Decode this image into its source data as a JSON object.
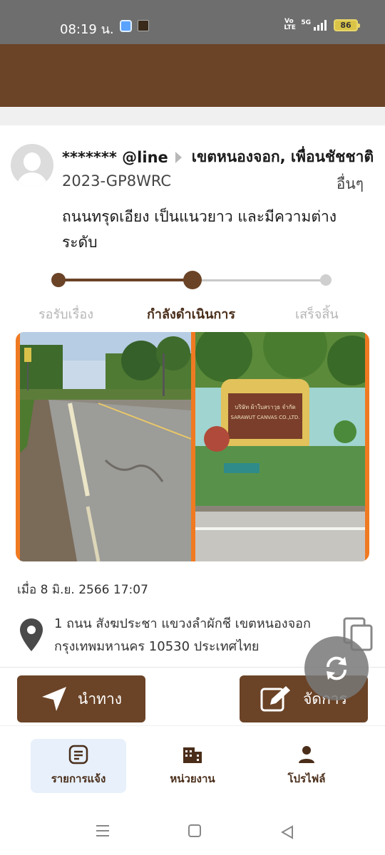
{
  "status_bar": {
    "time": "08:19 น.",
    "battery": "86",
    "network": "5G",
    "volte": "Vo LTE"
  },
  "report": {
    "user": "******* @line",
    "district": "เขตหนองจอก, เพื่อนชัชชาติ",
    "ticket_id": "2023-GP8WRC",
    "category": "อื่นๆ",
    "description": "ถนนทรุดเอียง เป็นแนวยาว และมีความต่าง ระดับ"
  },
  "progress": {
    "steps": [
      "รอรับเรื่อง",
      "กำลังดำเนินการ",
      "เสร็จสิ้น"
    ],
    "current_step": 2,
    "active_color": "#6b4326"
  },
  "photos": {
    "right_sign_line1": "บริษัท ผ้าใบสราวุธ จำกัด",
    "right_sign_line2": "SARAWUT CANVAS CO.,LTD."
  },
  "timestamp": "เมื่อ 8 มิ.ย. 2566 17:07",
  "address": "1 ถนน สังฆประชา แขวงลำผักชี เขตหนองจอก กรุงเทพมหานคร 10530 ประเทศไทย",
  "actions": {
    "navigate_label": "นำทาง",
    "manage_label": "จัดการ"
  },
  "bottom_nav": [
    {
      "label": "รายการแจ้ง",
      "icon": "list-icon",
      "active": true
    },
    {
      "label": "หน่วยงาน",
      "icon": "building-icon",
      "active": false
    },
    {
      "label": "โปรไฟล์",
      "icon": "person-icon",
      "active": false
    }
  ],
  "colors": {
    "brand_brown": "#6b4326",
    "accent_orange": "#f07a22",
    "nav_active_bg": "#e7f0fb"
  }
}
